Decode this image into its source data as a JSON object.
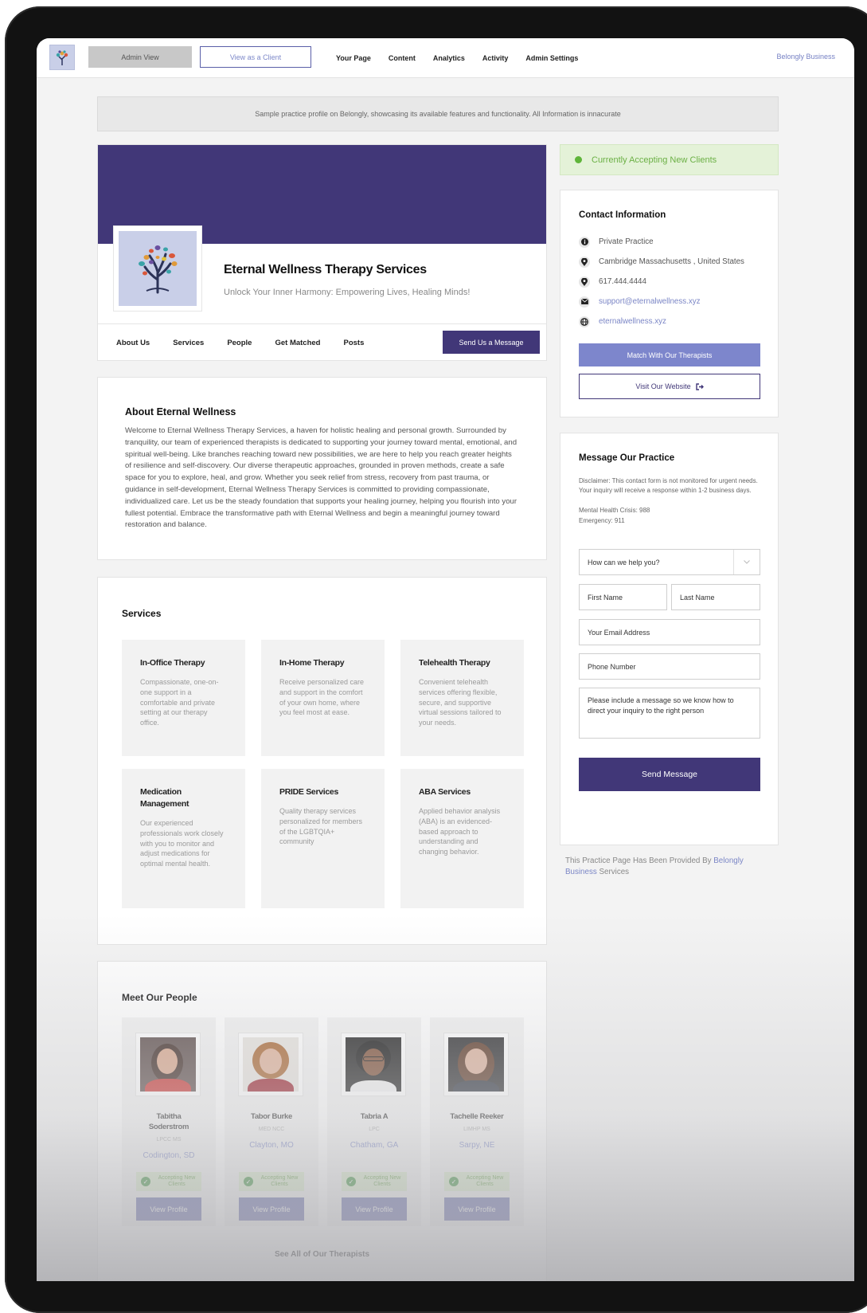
{
  "nav": {
    "admin_view": "Admin View",
    "view_as_client": "View as a Client",
    "links": [
      "Your Page",
      "Content",
      "Analytics",
      "Activity",
      "Admin Settings"
    ],
    "belongly_business": "Belongly Business"
  },
  "notice": "Sample practice profile on Belongly, showcasing its available features and functionality. All Information is innacurate",
  "profile": {
    "name": "Eternal Wellness Therapy Services",
    "tagline": "Unlock Your Inner Harmony: Empowering Lives, Healing Minds!",
    "tabs": [
      "About Us",
      "Services",
      "People",
      "Get Matched",
      "Posts"
    ],
    "send_message": "Send Us a Message"
  },
  "about": {
    "title": "About Eternal Wellness",
    "body": "Welcome to Eternal Wellness Therapy Services, a haven for holistic healing and personal growth. Surrounded by tranquility, our team of experienced therapists is dedicated to supporting your journey toward mental, emotional, and spiritual well-being. Like branches reaching toward new possibilities, we are here to help you reach greater heights of resilience and self-discovery. Our diverse therapeutic approaches, grounded in proven methods, create a safe space for you to explore, heal, and grow. Whether you seek relief from stress, recovery from past trauma, or guidance in self-development, Eternal Wellness Therapy Services is committed to providing compassionate, individualized care. Let us be the steady foundation that supports your healing journey, helping you flourish into your fullest potential. Embrace the transformative path with Eternal Wellness and begin a meaningful journey toward restoration and balance."
  },
  "services": {
    "title": "Services",
    "items": [
      {
        "title": "In-Office Therapy",
        "desc": "Compassionate, one-on-one support in a comfortable and private setting at our therapy office."
      },
      {
        "title": "In-Home Therapy",
        "desc": "Receive personalized care and support in the comfort of your own home, where you feel most at ease."
      },
      {
        "title": "Telehealth Therapy",
        "desc": "Convenient telehealth services offering flexible, secure, and supportive virtual sessions tailored to your needs."
      },
      {
        "title": "Medication Management",
        "desc": "Our experienced professionals work closely with you to monitor and adjust medications for optimal mental health."
      },
      {
        "title": "PRIDE Services",
        "desc": "Quality therapy services personalized for members of the LGBTQIA+ community"
      },
      {
        "title": "ABA Services",
        "desc": "Applied behavior analysis (ABA) is an evidenced-based approach to understanding and changing behavior."
      }
    ]
  },
  "people": {
    "title": "Meet Our People",
    "accepting_label": "Accepting New Clients",
    "view_profile": "View Profile",
    "see_all": "See All of Our Therapists",
    "items": [
      {
        "name": "Tabitha Soderstrom",
        "cred": "LPCC MS",
        "location": "Codington, SD"
      },
      {
        "name": "Tabor Burke",
        "cred": "MED NCC",
        "location": "Clayton, MO"
      },
      {
        "name": "Tabria A",
        "cred": "LPC",
        "location": "Chatham, GA"
      },
      {
        "name": "Tachelle Reeker",
        "cred": "LIMHP MS",
        "location": "Sarpy, NE"
      }
    ]
  },
  "status": {
    "accepting": "Currently Accepting New Clients"
  },
  "contact": {
    "title": "Contact Information",
    "practice_type": "Private Practice",
    "address": "Cambridge Massachusetts , United States",
    "phone": "617.444.4444",
    "email": "support@eternalwellness.xyz",
    "website": "eternalwellness.xyz",
    "match_button": "Match With Our Therapists",
    "visit_button": "Visit Our Website"
  },
  "message": {
    "title": "Message Our Practice",
    "disclaimer": "Disclaimer: This contact form is not monitored for urgent needs. Your inquiry will receive a response within 1-2 business days.",
    "crisis_line": "Mental Health Crisis: 988",
    "emergency_line": "Emergency: 911",
    "help_select": "How can we help you?",
    "first_name": "First Name",
    "last_name": "Last Name",
    "email": "Your Email Address",
    "phone": "Phone Number",
    "message_placeholder": "Please include a message so we know how to direct your inquiry to the right person",
    "send_button": "Send Message"
  },
  "footer": {
    "provided_prefix": "This Practice Page Has Been Provided By",
    "provided_link": "Belongly Business",
    "provided_suffix": "Services"
  },
  "colors": {
    "brand_purple": "#413778",
    "accent_blue": "#7d86cc",
    "accepting_green": "#5fb53a"
  }
}
